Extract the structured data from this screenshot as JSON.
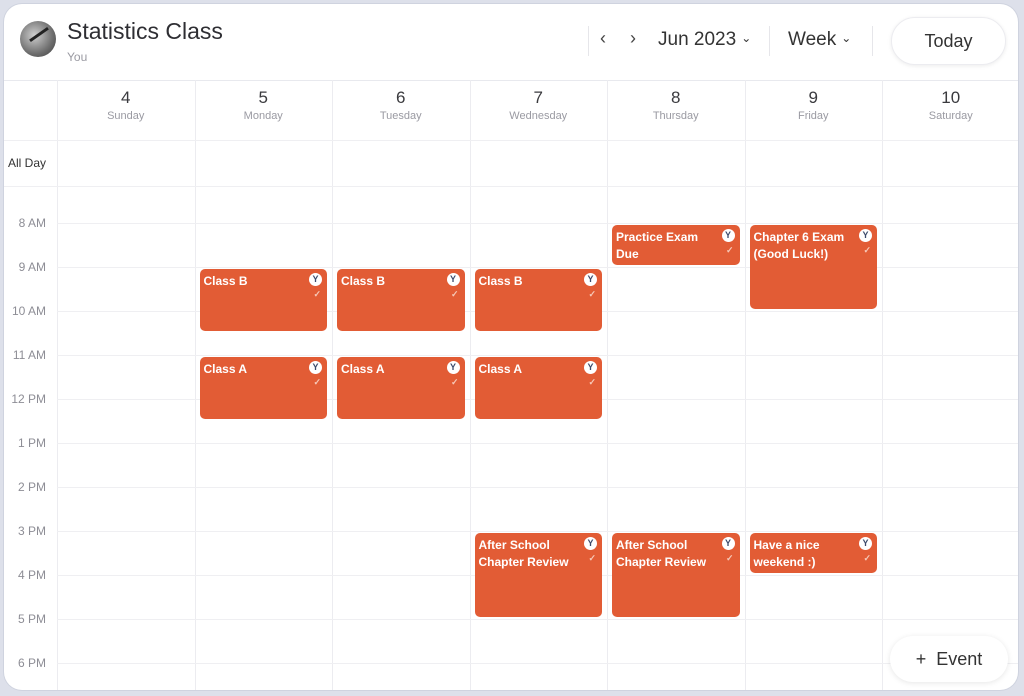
{
  "header": {
    "title": "Statistics Class",
    "subtitle": "You",
    "prev_icon": "‹",
    "next_icon": "›",
    "month": "Jun 2023",
    "view": "Week",
    "chevron": "⌄",
    "today_label": "Today"
  },
  "days": [
    {
      "num": "4",
      "name": "Sunday"
    },
    {
      "num": "5",
      "name": "Monday"
    },
    {
      "num": "6",
      "name": "Tuesday"
    },
    {
      "num": "7",
      "name": "Wednesday"
    },
    {
      "num": "8",
      "name": "Thursday"
    },
    {
      "num": "9",
      "name": "Friday"
    },
    {
      "num": "10",
      "name": "Saturday"
    }
  ],
  "all_day_label": "All Day",
  "times": [
    "8 AM",
    "9 AM",
    "10 AM",
    "11 AM",
    "12 PM",
    "1 PM",
    "2 PM",
    "3 PM",
    "4 PM",
    "5 PM",
    "6 PM"
  ],
  "event_color": "#e25c35",
  "events": [
    {
      "title": "Class B",
      "day": 1,
      "start": 9,
      "end": 10.5,
      "badge": "Y",
      "check": "✓"
    },
    {
      "title": "Class B",
      "day": 2,
      "start": 9,
      "end": 10.5,
      "badge": "Y",
      "check": "✓"
    },
    {
      "title": "Class B",
      "day": 3,
      "start": 9,
      "end": 10.5,
      "badge": "Y",
      "check": "✓"
    },
    {
      "title": "Class A",
      "day": 1,
      "start": 11,
      "end": 12.5,
      "badge": "Y",
      "check": "✓"
    },
    {
      "title": "Class A",
      "day": 2,
      "start": 11,
      "end": 12.5,
      "badge": "Y",
      "check": "✓"
    },
    {
      "title": "Class A",
      "day": 3,
      "start": 11,
      "end": 12.5,
      "badge": "Y",
      "check": "✓"
    },
    {
      "title": "Practice Exam Due",
      "day": 4,
      "start": 8,
      "end": 9,
      "badge": "Y",
      "check": "✓"
    },
    {
      "title": "Chapter 6 Exam (Good Luck!)",
      "day": 5,
      "start": 8,
      "end": 10,
      "badge": "Y",
      "check": "✓"
    },
    {
      "title": "After School Chapter Review",
      "day": 3,
      "start": 15,
      "end": 17,
      "badge": "Y",
      "check": "✓"
    },
    {
      "title": "After School Chapter Review",
      "day": 4,
      "start": 15,
      "end": 17,
      "badge": "Y",
      "check": "✓"
    },
    {
      "title": "Have a nice weekend :)",
      "day": 5,
      "start": 15,
      "end": 16,
      "badge": "Y",
      "check": "✓"
    }
  ],
  "add_event": {
    "icon": "+",
    "label": "Event"
  }
}
